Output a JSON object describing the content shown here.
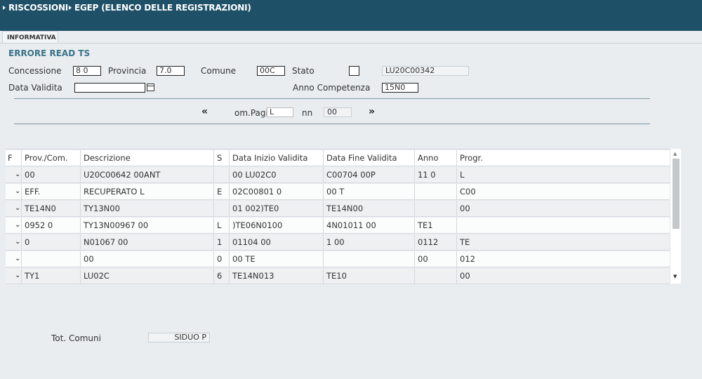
{
  "header": {
    "crumb1": "RISCOSSIONI",
    "crumb2": "EGEP (ELENCO DELLE REGISTRAZIONI)"
  },
  "tabs": {
    "active": "INFORMATIVA"
  },
  "form": {
    "section_title": "ERRORE READ TS",
    "concessione_label": "Concessione",
    "concessione_value": "8 0",
    "provincia_label": "Provincia",
    "provincia_value": "7.0",
    "comune_label": "Comune",
    "comune_value": "00C",
    "stato_label": "Stato",
    "stato_value": "",
    "code_value": "LU20C00342",
    "data_validita_label": "Data Validita",
    "data_validita_value": "",
    "anno_competenza_label": "Anno Competenza",
    "anno_competenza_value": "15N0"
  },
  "pager": {
    "prev": "«",
    "label": "om.Pagi",
    "value": "L",
    "nn_label": "nn",
    "nn_value": "00",
    "next": "»"
  },
  "table": {
    "headers": [
      "F",
      "Prov./Com.",
      "Descrizione",
      "S",
      "Data Inizio Validita",
      "Data Fine Validita",
      "Anno",
      "Progr."
    ],
    "rows": [
      [
        "00",
        "U20C00642 00ANT",
        "",
        "00 LU02C0",
        "C00704 00P",
        "11 0",
        "L"
      ],
      [
        "EFF.",
        "RECUPERATO    L",
        "E",
        "02C00801 0",
        "00      T",
        "",
        "C00"
      ],
      [
        "TE14N0",
        "         TY13N00",
        "",
        "01 002)TE0",
        "   TE14N00",
        "",
        "00"
      ],
      [
        "0952 0",
        "  TY13N00967 00",
        "L",
        ")TE06N0100",
        "4N01011 00",
        "TE1",
        ""
      ],
      [
        "0",
        "N01067 00",
        "1",
        "01104 00",
        "1 00",
        "0112",
        "TE"
      ],
      [
        "",
        "00",
        "0",
        "00     TE",
        "",
        "00",
        "012"
      ],
      [
        "   TY1",
        "            LU02C",
        "6",
        "  TE14N013",
        "           TE10",
        "",
        "00"
      ]
    ]
  },
  "footer": {
    "tot_label": "Tot. Comuni",
    "tot_value": "SIDUO P"
  },
  "colors": {
    "titlebar": "#1e5068",
    "background": "#e9edf0",
    "section_title": "#3a7489"
  },
  "icons": {
    "calendar": "calendar-icon",
    "row_toggle": "chevron-down-icon"
  }
}
